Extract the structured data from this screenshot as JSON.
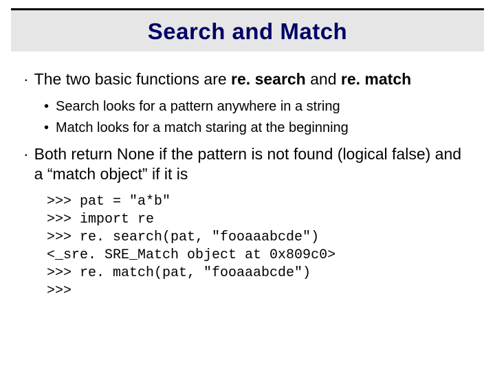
{
  "title": "Search and Match",
  "bullets": [
    {
      "pre": "The two basic functions are ",
      "bold1": "re. search",
      "mid": " and ",
      "bold2": "re. match",
      "post": ""
    },
    {
      "pre": "Both return None if the pattern is not found (logical false)  and a “match object” if it is",
      "bold1": "",
      "mid": "",
      "bold2": "",
      "post": ""
    }
  ],
  "sub_bullets": [
    "Search looks for a pattern anywhere in a string",
    "Match looks for a match staring at the beginning"
  ],
  "code_lines": [
    ">>> pat = \"a*b\"",
    ">>> import re",
    ">>> re. search(pat, \"fooaaabcde\")",
    "<_sre. SRE_Match object at 0x809c0>",
    ">>> re. match(pat, \"fooaaabcde\")",
    ">>>"
  ]
}
